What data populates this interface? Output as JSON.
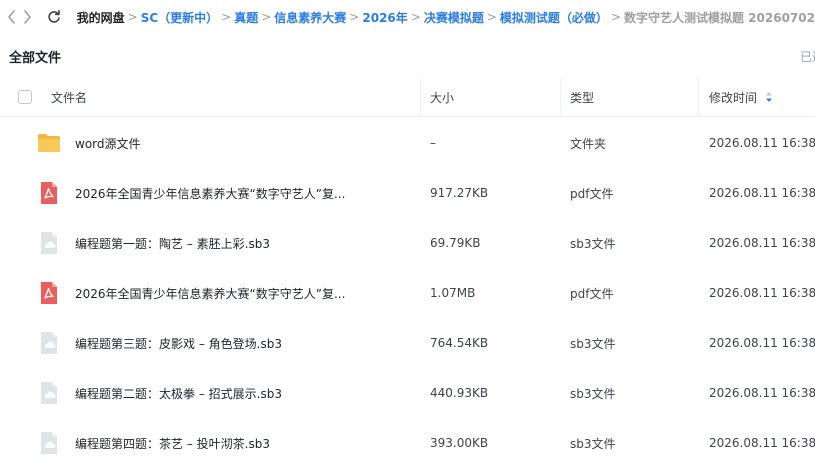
{
  "breadcrumb": {
    "root": "我的网盘",
    "links": [
      "SC（更新中）",
      "真题",
      "信息素养大赛",
      "2026年",
      "决赛模拟题",
      "模拟测试题（必做）"
    ],
    "current": "数字守艺人测试模拟题 20260702",
    "separator": ">"
  },
  "section": {
    "title": "全部文件",
    "selected_hint": "已选"
  },
  "table": {
    "columns": {
      "name": "文件名",
      "size": "大小",
      "type": "类型",
      "modified": "修改时间"
    },
    "rows": [
      {
        "icon": "folder-icon",
        "name": "word源文件",
        "size": "–",
        "type": "文件夹",
        "modified": "2026.08.11 16:38"
      },
      {
        "icon": "pdf-icon",
        "name": "2026年全国青少年信息素养大赛“数字守艺人”复...",
        "size": "917.27KB",
        "type": "pdf文件",
        "modified": "2026.08.11 16:38"
      },
      {
        "icon": "cloud-file-icon",
        "name": "编程题第一题：陶艺 – 素胚上彩.sb3",
        "size": "69.79KB",
        "type": "sb3文件",
        "modified": "2026.08.11 16:38"
      },
      {
        "icon": "pdf-icon",
        "name": "2026年全国青少年信息素养大赛“数字守艺人”复...",
        "size": "1.07MB",
        "type": "pdf文件",
        "modified": "2026.08.11 16:38"
      },
      {
        "icon": "cloud-file-icon",
        "name": "编程题第三题：皮影戏 – 角色登场.sb3",
        "size": "764.54KB",
        "type": "sb3文件",
        "modified": "2026.08.11 16:38"
      },
      {
        "icon": "cloud-file-icon",
        "name": "编程题第二题：太极拳 – 招式展示.sb3",
        "size": "440.93KB",
        "type": "sb3文件",
        "modified": "2026.08.11 16:38"
      },
      {
        "icon": "cloud-file-icon",
        "name": "编程题第四题：茶艺 – 投叶沏茶.sb3",
        "size": "393.00KB",
        "type": "sb3文件",
        "modified": "2026.08.11 16:38"
      }
    ]
  },
  "colors": {
    "link": "#2b7de9",
    "muted": "#9aa0a6",
    "folder": "#f5b83d",
    "pdf": "#ec5e5e",
    "cloud_file": "#dfe2e6",
    "sort_active": "#2b7de9"
  }
}
